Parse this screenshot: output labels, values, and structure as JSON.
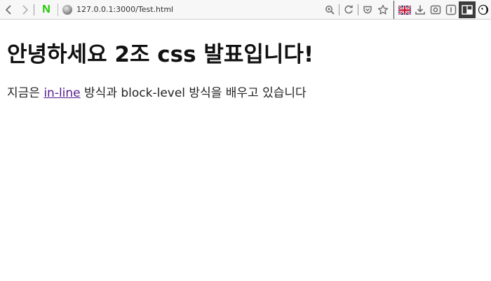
{
  "browser": {
    "url": "127.0.0.1:3000/Test.html",
    "n_logo_text": "N",
    "icons": {
      "back": "chevron-left-icon",
      "forward": "chevron-right-icon",
      "zoom": "zoom-icon",
      "reload": "reload-icon",
      "pocket": "pocket-icon",
      "bookmark": "star-icon",
      "language": "uk-flag-icon",
      "download": "download-icon",
      "screenshot": "camera-icon",
      "reader": "reader-icon",
      "sidebar": "sidebar-panel-icon",
      "extension": "extension-icon"
    },
    "colors": {
      "n_logo": "#1ec800",
      "link_visited": "#551a8b"
    }
  },
  "page": {
    "heading": "안녕하세요 2조 css 발표입니다!",
    "paragraph": {
      "before": "지금은 ",
      "link": "in-line",
      "after": " 방식과 block-level 방식을 배우고 있습니다"
    }
  }
}
